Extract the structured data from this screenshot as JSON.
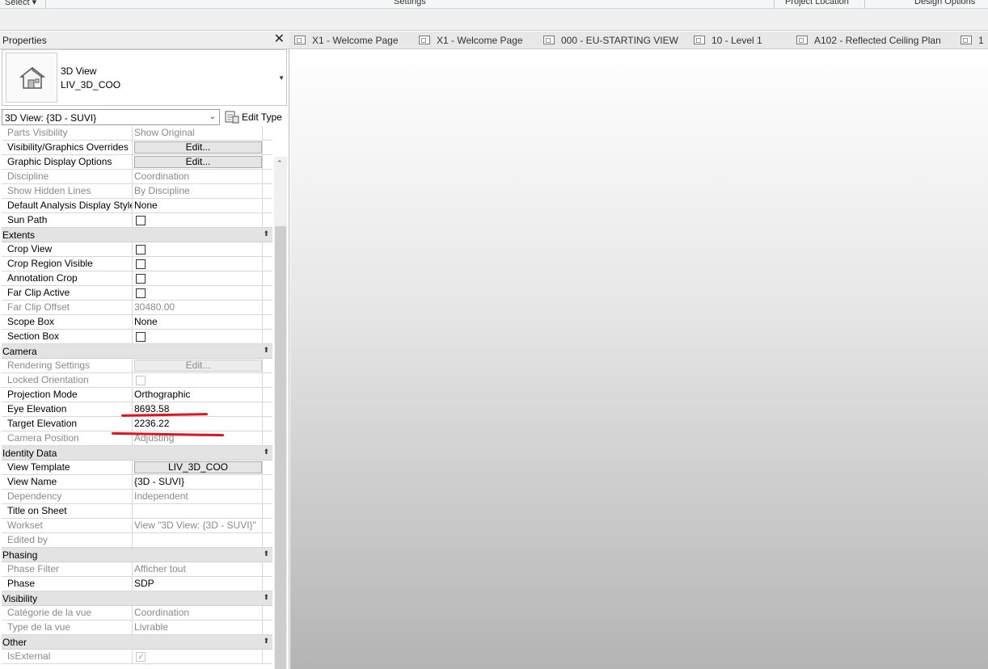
{
  "ribbon": {
    "select_label": "Select",
    "settings_label": "Settings",
    "project_location_label": "Project Location",
    "design_options_label": "Design Options"
  },
  "properties": {
    "title": "Properties",
    "type_family": "3D View",
    "type_name": "LIV_3D_COO",
    "view_selector": "3D View: {3D - SUVI}",
    "edit_type_label": "Edit Type",
    "rows": [
      {
        "kind": "row",
        "name": "Parts Visibility",
        "value": "Show Original",
        "disabled": true
      },
      {
        "kind": "button",
        "name": "Visibility/Graphics Overrides",
        "value": "Edit...",
        "disabled": false
      },
      {
        "kind": "button",
        "name": "Graphic Display Options",
        "value": "Edit...",
        "disabled": false
      },
      {
        "kind": "row",
        "name": "Discipline",
        "value": "Coordination",
        "disabled": true
      },
      {
        "kind": "row",
        "name": "Show Hidden Lines",
        "value": "By Discipline",
        "disabled": true
      },
      {
        "kind": "row",
        "name": "Default Analysis Display Style",
        "value": "None",
        "disabled": false
      },
      {
        "kind": "check",
        "name": "Sun Path",
        "checked": false,
        "disabled": false
      },
      {
        "kind": "category",
        "name": "Extents"
      },
      {
        "kind": "check",
        "name": "Crop View",
        "checked": false,
        "disabled": false
      },
      {
        "kind": "check",
        "name": "Crop Region Visible",
        "checked": false,
        "disabled": false
      },
      {
        "kind": "check",
        "name": "Annotation Crop",
        "checked": false,
        "disabled": false
      },
      {
        "kind": "check",
        "name": "Far Clip Active",
        "checked": false,
        "disabled": false
      },
      {
        "kind": "row",
        "name": "Far Clip Offset",
        "value": "30480.00",
        "disabled": true
      },
      {
        "kind": "row",
        "name": "Scope Box",
        "value": "None",
        "disabled": false
      },
      {
        "kind": "check",
        "name": "Section Box",
        "checked": false,
        "disabled": false
      },
      {
        "kind": "category",
        "name": "Camera"
      },
      {
        "kind": "button",
        "name": "Rendering Settings",
        "value": "Edit...",
        "disabled": true
      },
      {
        "kind": "check",
        "name": "Locked Orientation",
        "checked": false,
        "disabled": true
      },
      {
        "kind": "row",
        "name": "Projection Mode",
        "value": "Orthographic",
        "disabled": false
      },
      {
        "kind": "row",
        "name": "Eye Elevation",
        "value": "8693.58",
        "disabled": false
      },
      {
        "kind": "row",
        "name": "Target Elevation",
        "value": "2236.22",
        "disabled": false
      },
      {
        "kind": "row",
        "name": "Camera Position",
        "value": "Adjusting",
        "disabled": true
      },
      {
        "kind": "category",
        "name": "Identity Data"
      },
      {
        "kind": "button",
        "name": "View Template",
        "value": "LIV_3D_COO",
        "disabled": false
      },
      {
        "kind": "row",
        "name": "View Name",
        "value": "{3D - SUVI}",
        "disabled": false
      },
      {
        "kind": "row",
        "name": "Dependency",
        "value": "Independent",
        "disabled": true
      },
      {
        "kind": "row",
        "name": "Title on Sheet",
        "value": "",
        "disabled": false
      },
      {
        "kind": "row",
        "name": "Workset",
        "value": "View \"3D View: {3D - SUVI}\"",
        "disabled": true
      },
      {
        "kind": "row",
        "name": "Edited by",
        "value": "",
        "disabled": true
      },
      {
        "kind": "category",
        "name": "Phasing"
      },
      {
        "kind": "row",
        "name": "Phase Filter",
        "value": "Afficher tout",
        "disabled": true
      },
      {
        "kind": "row",
        "name": "Phase",
        "value": "SDP",
        "disabled": false
      },
      {
        "kind": "category",
        "name": "Visibility"
      },
      {
        "kind": "row",
        "name": "Catégorie de la vue",
        "value": "Coordination",
        "disabled": true
      },
      {
        "kind": "row",
        "name": "Type de la vue",
        "value": "Livrable",
        "disabled": true
      },
      {
        "kind": "category",
        "name": "Other"
      },
      {
        "kind": "check",
        "name": "IsExternal",
        "checked": true,
        "disabled": true
      }
    ]
  },
  "tabs": [
    {
      "label": "X1 - Welcome Page"
    },
    {
      "label": "X1 - Welcome Page"
    },
    {
      "label": "000 - EU-STARTING VIEW"
    },
    {
      "label": "10 - Level 1"
    },
    {
      "label": "A102 - Reflected Ceiling Plan"
    },
    {
      "label": "1"
    }
  ],
  "colors": {
    "annotation_red": "#e0141e"
  }
}
